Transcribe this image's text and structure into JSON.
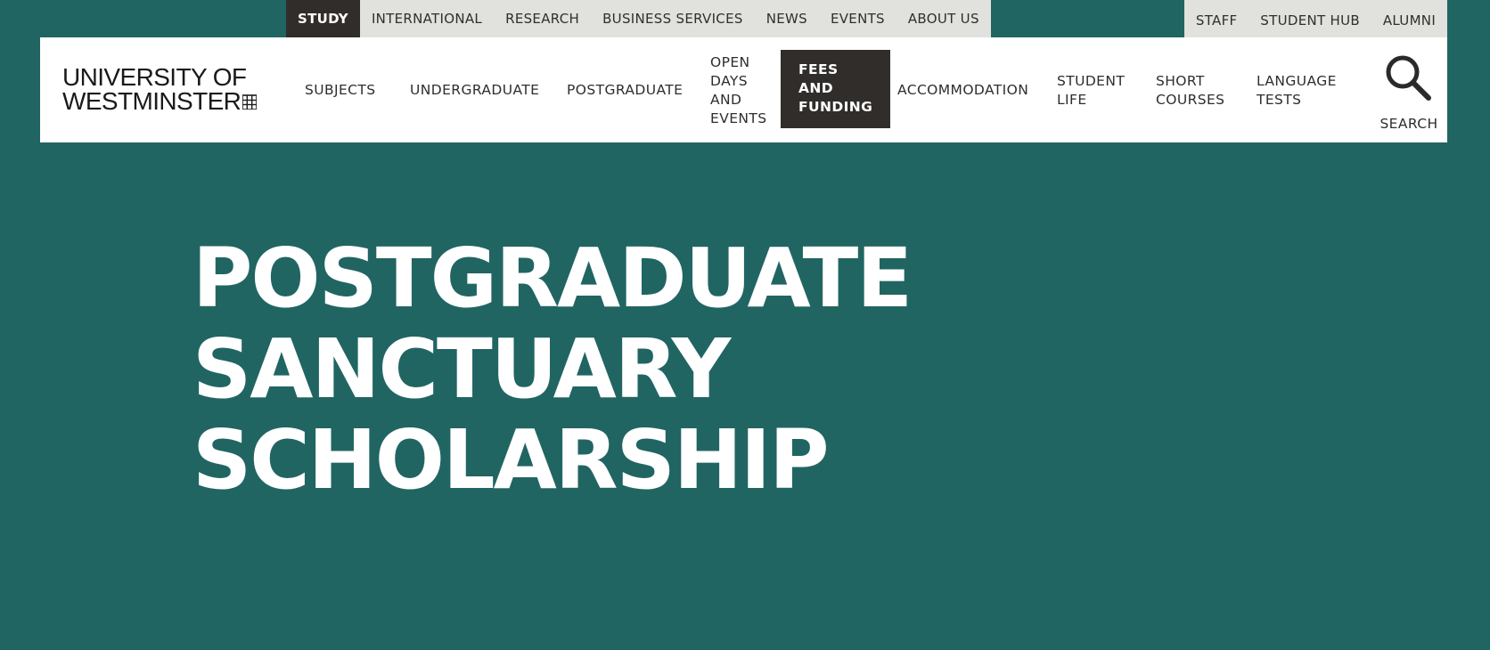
{
  "utility_nav": {
    "left_items": [
      {
        "label": "STUDY",
        "active": true
      },
      {
        "label": "INTERNATIONAL"
      },
      {
        "label": "RESEARCH"
      },
      {
        "label": "BUSINESS SERVICES"
      },
      {
        "label": "NEWS"
      },
      {
        "label": "EVENTS"
      },
      {
        "label": "ABOUT US"
      }
    ],
    "right_items": [
      {
        "label": "STAFF"
      },
      {
        "label": "STUDENT HUB"
      },
      {
        "label": "ALUMNI"
      }
    ]
  },
  "logo": {
    "line1": "UNIVERSITY OF",
    "line2": "WESTMINSTER",
    "icon": "portcullis-icon"
  },
  "main_nav": {
    "items": [
      {
        "label": "SUBJECTS"
      },
      {
        "label": "UNDERGRADUATE"
      },
      {
        "label": "POSTGRADUATE"
      },
      {
        "label": "OPEN\nDAYS\nAND\nEVENTS"
      },
      {
        "label": "FEES\nAND\nFUNDING",
        "active": true
      },
      {
        "label": "ACCOMMODATION"
      },
      {
        "label": "STUDENT\nLIFE"
      },
      {
        "label": "SHORT\nCOURSES"
      },
      {
        "label": "LANGUAGE\nTESTS"
      }
    ],
    "search_label": "SEARCH",
    "search_icon": "search-icon"
  },
  "hero": {
    "title_lines": [
      "POSTGRADUATE",
      "SANCTUARY",
      "SCHOLARSHIP"
    ]
  },
  "colors": {
    "background": "#216563",
    "utility_bar": "#e1e1dd",
    "active_tab": "#302d2a",
    "header": "#ffffff"
  }
}
